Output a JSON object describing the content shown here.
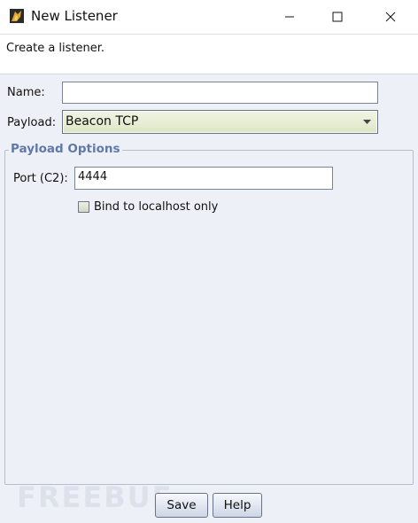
{
  "window": {
    "title": "New Listener",
    "icons": {
      "app": "cobalt-strike-app-icon",
      "minimize": "minimize-icon",
      "maximize": "maximize-icon",
      "close": "close-icon"
    }
  },
  "header": {
    "text": "Create a listener."
  },
  "form": {
    "name_label": "Name:",
    "name_value": "",
    "payload_label": "Payload:",
    "payload_value": "Beacon TCP"
  },
  "payload_options": {
    "legend": "Payload Options",
    "port_label": "Port (C2):",
    "port_value": "4444",
    "bind_localhost_label": "Bind to localhost only",
    "bind_localhost_checked": false
  },
  "buttons": {
    "save": "Save",
    "help": "Help"
  },
  "watermark": {
    "text": "FREEBUF"
  }
}
